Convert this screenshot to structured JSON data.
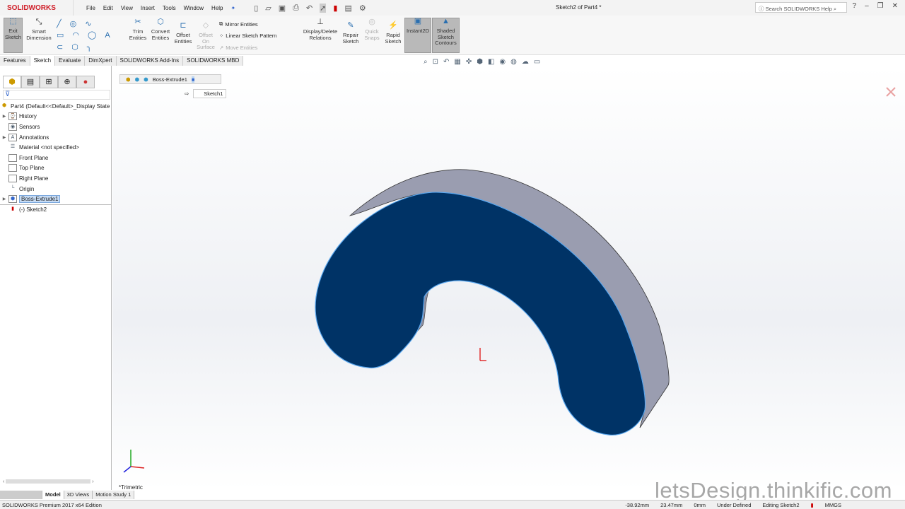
{
  "app": {
    "logo": "SOLIDWORKS",
    "document_title": "Sketch2 of Part4 *",
    "help_search_placeholder": "Search SOLIDWORKS Help"
  },
  "menu": [
    "File",
    "Edit",
    "View",
    "Insert",
    "Tools",
    "Window",
    "Help"
  ],
  "ribbon": {
    "exit_sketch": "Exit Sketch",
    "smart_dimension": "Smart Dimension",
    "trim": "Trim Entities",
    "convert": "Convert Entities",
    "offset": "Offset Entities",
    "offset_surface": "Offset On Surface",
    "mirror": "Mirror Entities",
    "linear_pattern": "Linear Sketch Pattern",
    "move": "Move Entities",
    "display_delete": "Display/Delete Relations",
    "repair": "Repair Sketch",
    "quick_snaps": "Quick Snaps",
    "rapid": "Rapid Sketch",
    "instant2d": "Instant2D",
    "shaded": "Shaded Sketch Contours"
  },
  "command_tabs": [
    "Features",
    "Sketch",
    "Evaluate",
    "DimXpert",
    "SOLIDWORKS Add-Ins",
    "SOLIDWORKS MBD"
  ],
  "tree": {
    "root": "Part4  (Default<<Default>_Display State",
    "items": [
      "History",
      "Sensors",
      "Annotations",
      "Material <not specified>",
      "Front Plane",
      "Top Plane",
      "Right Plane",
      "Origin",
      "Boss-Extrude1",
      "(-) Sketch2"
    ]
  },
  "breadcrumb": {
    "feature": "Boss-Extrude1",
    "sketch": "Sketch1"
  },
  "view_name": "*Trimetric",
  "bottom_tabs": [
    "Model",
    "3D Views",
    "Motion Study 1"
  ],
  "status": {
    "edition": "SOLIDWORKS Premium 2017 x64 Edition",
    "x": "-38.92mm",
    "y": "23.47mm",
    "z": "0mm",
    "state": "Under Defined",
    "editing": "Editing Sketch2",
    "units": "MMGS"
  },
  "watermark": "letsDesign.thinkific.com",
  "colors": {
    "face": "#003366",
    "side": "#9a9db0",
    "edge": "#5aa8f0"
  }
}
